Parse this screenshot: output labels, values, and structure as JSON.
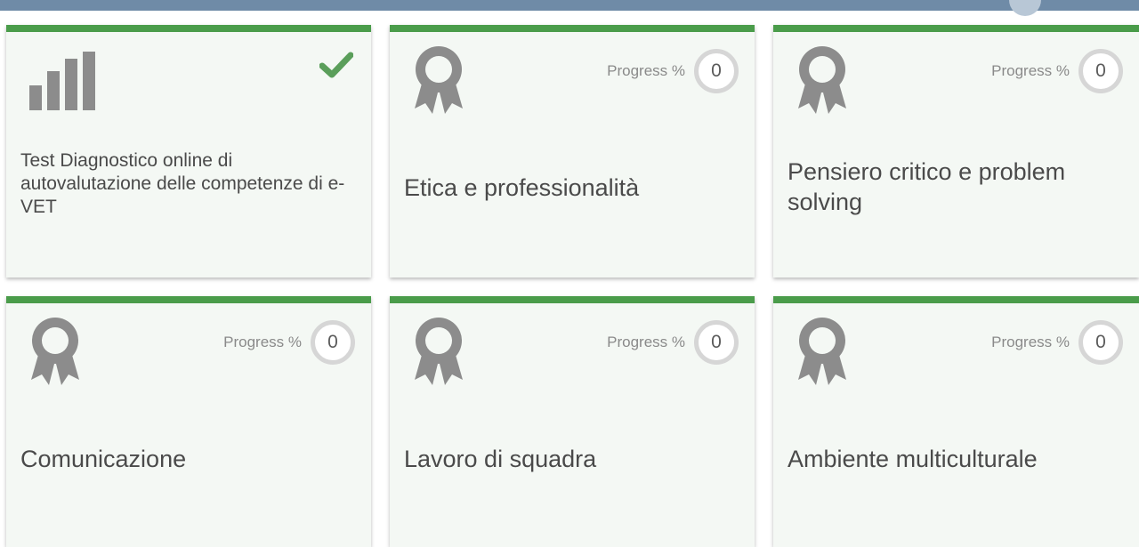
{
  "cards": [
    {
      "title": "Test Diagnostico online di autovalutazione delle competenze di e-VET",
      "icon": "bar-chart-icon",
      "completed": true
    },
    {
      "title": "Etica e professionalità",
      "icon": "award-icon",
      "progress_label": "Progress %",
      "progress_value": "0"
    },
    {
      "title": "Pensiero critico e problem solving",
      "icon": "award-icon",
      "progress_label": "Progress %",
      "progress_value": "0"
    },
    {
      "title": "Comunicazione",
      "icon": "award-icon",
      "progress_label": "Progress %",
      "progress_value": "0"
    },
    {
      "title": "Lavoro di squadra",
      "icon": "award-icon",
      "progress_label": "Progress %",
      "progress_value": "0"
    },
    {
      "title": "Ambiente multiculturale",
      "icon": "award-icon",
      "progress_label": "Progress %",
      "progress_value": "0"
    }
  ],
  "colors": {
    "accent_green": "#4a9c4a",
    "card_background": "#f4f8f4",
    "icon_gray": "#8c8c8c",
    "top_bar": "#6f8ba7"
  }
}
